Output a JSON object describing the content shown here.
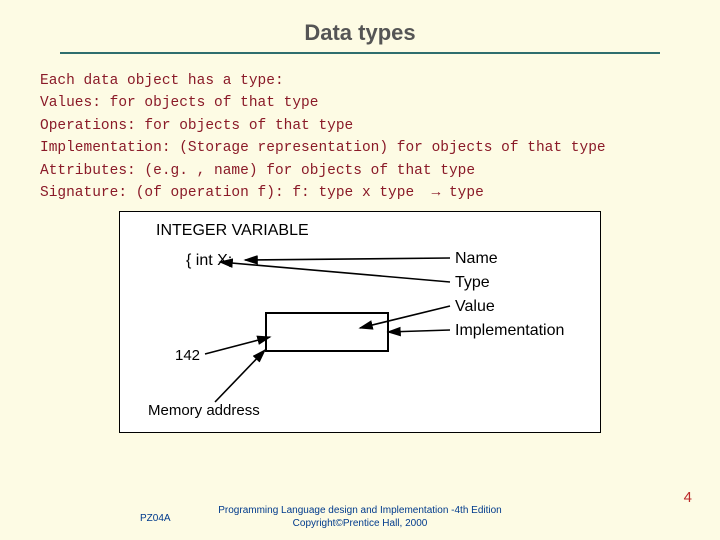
{
  "title": "Data types",
  "body": "Each data object has a type:\nValues: for objects of that type\nOperations: for objects of that type\nImplementation: (Storage representation) for objects of that type\nAttributes: (e.g. , name) for objects of that type\nSignature: (of operation f): f: type x type  → type",
  "diagram": {
    "heading": "INTEGER VARIABLE",
    "decl": "{ int X;",
    "value": "142",
    "mem": "Memory address",
    "labels": {
      "name": "Name",
      "type": "Type",
      "value": "Value",
      "impl": "Implementation"
    }
  },
  "footer": {
    "left": "PZ04A",
    "mid1": "Programming Language design and Implementation -4th Edition",
    "mid2": "Copyright©Prentice Hall, 2000"
  },
  "page": "4"
}
